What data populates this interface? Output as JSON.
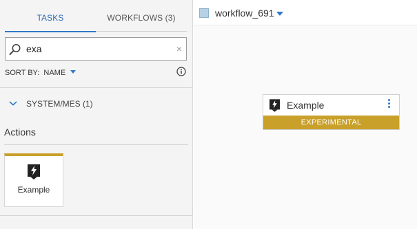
{
  "tabs": [
    {
      "label": "TASKS",
      "active": true
    },
    {
      "label": "WORKFLOWS (3)",
      "active": false
    }
  ],
  "search": {
    "value": "exa",
    "placeholder": "",
    "clear_glyph": "×"
  },
  "sort": {
    "label": "SORT BY:",
    "value": "NAME"
  },
  "group": {
    "label": "SYSTEM/MES (1)",
    "expanded": true
  },
  "actions": {
    "title": "Actions",
    "items": [
      {
        "label": "Example",
        "icon": "lightning-bolt-icon"
      }
    ]
  },
  "workflow": {
    "title": "workflow_691"
  },
  "node": {
    "label": "Example",
    "badge": "EXPERIMENTAL",
    "icon": "lightning-bolt-icon"
  },
  "colors": {
    "accent": "#2f79c8",
    "experimental": "#c9a02a",
    "workflow_icon": "#b6d1e6"
  }
}
